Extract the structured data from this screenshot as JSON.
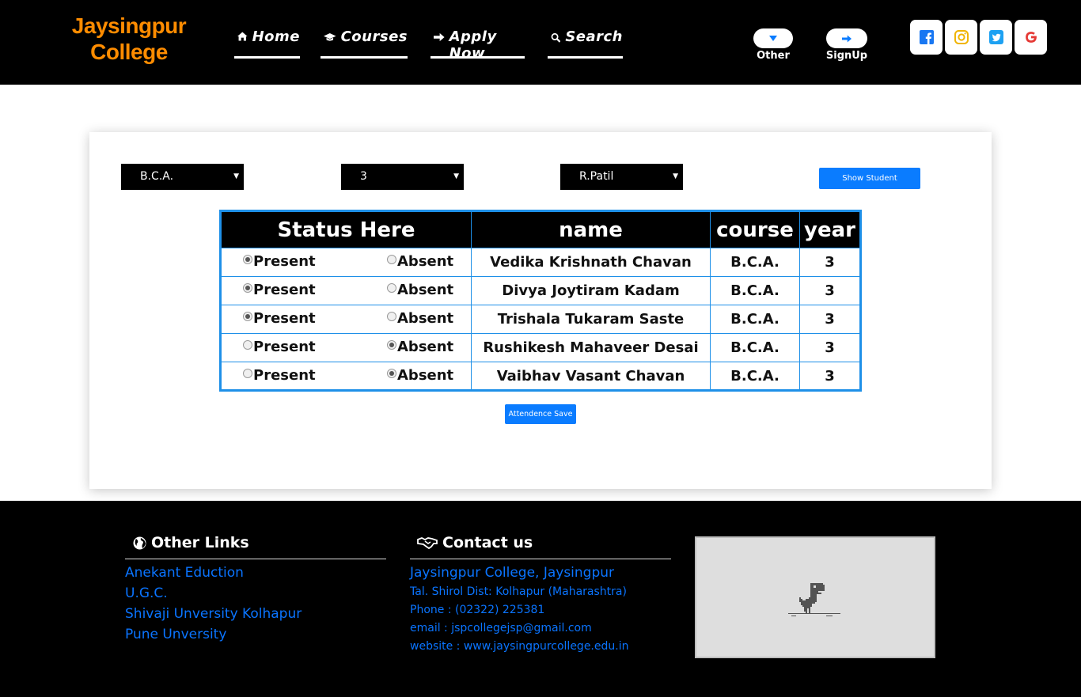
{
  "header": {
    "logo_line1": "Jaysingpur",
    "logo_line2": "College",
    "nav": [
      {
        "label": "Home",
        "icon": "home-icon"
      },
      {
        "label": "Courses",
        "icon": "graduation-cap-icon"
      },
      {
        "label": "Apply Now",
        "icon": "arrow-right-icon"
      },
      {
        "label": "Search",
        "icon": "search-icon"
      }
    ],
    "other_label": "Other",
    "signup_label": "SignUp",
    "social": [
      "facebook-icon",
      "instagram-icon",
      "twitter-icon",
      "google-icon"
    ],
    "colors": {
      "logo": "#ff8c00",
      "accent": "#0a7cff"
    }
  },
  "filters": {
    "course": "B.C.A.",
    "year": "3",
    "teacher": "R.Patil",
    "show_button": "Show Student"
  },
  "table": {
    "headers": [
      "Status Here",
      "name",
      "course",
      "year"
    ],
    "present_label": "Present",
    "absent_label": "Absent",
    "rows": [
      {
        "status": "present",
        "name": "Vedika Krishnath Chavan",
        "course": "B.C.A.",
        "year": "3"
      },
      {
        "status": "present",
        "name": "Divya Joytiram Kadam",
        "course": "B.C.A.",
        "year": "3"
      },
      {
        "status": "present",
        "name": "Trishala Tukaram Saste",
        "course": "B.C.A.",
        "year": "3"
      },
      {
        "status": "absent",
        "name": "Rushikesh Mahaveer Desai",
        "course": "B.C.A.",
        "year": "3"
      },
      {
        "status": "absent",
        "name": "Vaibhav Vasant Chavan",
        "course": "B.C.A.",
        "year": "3"
      }
    ],
    "save_button": "Attendence Save"
  },
  "footer": {
    "links_title": "Other Links",
    "links": [
      "Anekant Eduction",
      "U.G.C.",
      "Shivaji Unversity Kolhapur",
      "Pune Unversity"
    ],
    "contact_title": "Contact us",
    "contact_name": "Jaysingpur College, Jaysingpur",
    "contact_lines": [
      "Tal. Shirol Dist: Kolhapur (Maharashtra)",
      "Phone : (02322) 225381",
      "email : jspcollegejsp@gmail.com",
      "website : www.jaysingpurcollege.edu.in"
    ]
  }
}
